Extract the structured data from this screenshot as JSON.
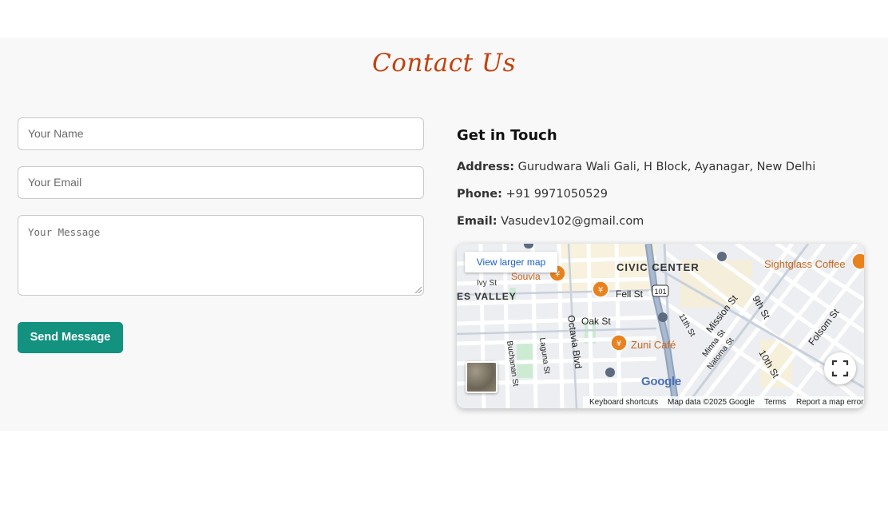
{
  "page": {
    "title": "Contact Us",
    "colors": {
      "title": "#c4410e",
      "button": "#12927f",
      "section_bg": "#f8f8f8"
    }
  },
  "form": {
    "name_placeholder": "Your Name",
    "email_placeholder": "Your Email",
    "message_placeholder": "Your Message",
    "submit_label": "Send Message"
  },
  "contact": {
    "heading": "Get in Touch",
    "address_label": "Address:",
    "address_value": "Gurudwara Wali Gali, H Block, Ayanagar, New Delhi",
    "phone_label": "Phone:",
    "phone_value": "+91 9971050529",
    "email_label": "Email:",
    "email_value": "Vasudev102@gmail.com"
  },
  "map": {
    "view_larger": "View larger map",
    "google_logo": "Google",
    "keyboard_shortcuts": "Keyboard shortcuts",
    "map_data": "Map data ©2025 Google",
    "terms": "Terms",
    "report": "Report a map error",
    "labels": {
      "civic_center": "CIVIC CENTER",
      "sightglass": "Sightglass Coffee",
      "souvla": "Souvla",
      "ivy": "Ivy St",
      "hayes_valley": "ES VALLEY",
      "fell": "Fell St",
      "oak": "Oak St",
      "octavia": "Octavia Blvd",
      "buchanan": "Buchanan St",
      "laguna": "Laguna St",
      "zuni": "Zuni Café",
      "eleventh": "11th St",
      "mission": "Mission St",
      "ninth": "9th St",
      "folsom": "Folsom St",
      "minna": "Minna St",
      "natoma": "Natoma St",
      "tenth": "10th St",
      "highway": "101"
    }
  }
}
